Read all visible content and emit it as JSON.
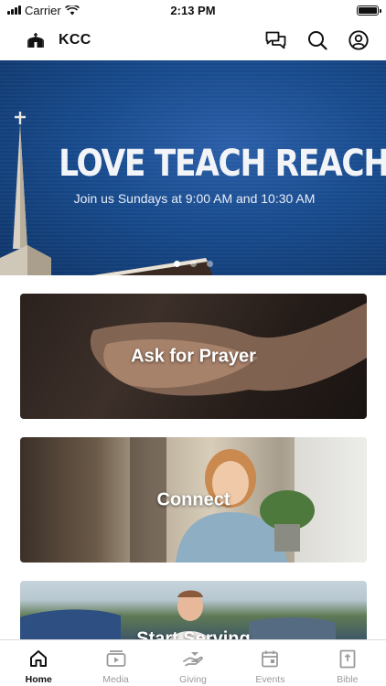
{
  "status_bar": {
    "carrier": "Carrier",
    "time": "2:13 PM",
    "battery_level": 1.0
  },
  "header": {
    "title": "KCC",
    "icons": [
      "messages-icon",
      "search-icon",
      "account-icon"
    ]
  },
  "hero": {
    "title": "LOVE TEACH REACH",
    "subtitle": "Join us Sundays at 9:00 AM and 10:30 AM",
    "slide_count": 3,
    "active_slide": 1
  },
  "cards": [
    {
      "label": "Ask for Prayer"
    },
    {
      "label": "Connect"
    },
    {
      "label": "Start Serving"
    }
  ],
  "tabs": [
    {
      "label": "Home",
      "icon": "home-icon",
      "active": true
    },
    {
      "label": "Media",
      "icon": "media-icon",
      "active": false
    },
    {
      "label": "Giving",
      "icon": "giving-icon",
      "active": false
    },
    {
      "label": "Events",
      "icon": "events-icon",
      "active": false
    },
    {
      "label": "Bible",
      "icon": "bible-icon",
      "active": false
    }
  ],
  "colors": {
    "accent": "#111111",
    "inactive": "#9a9a9a",
    "hero_blue": "#174a8c"
  }
}
